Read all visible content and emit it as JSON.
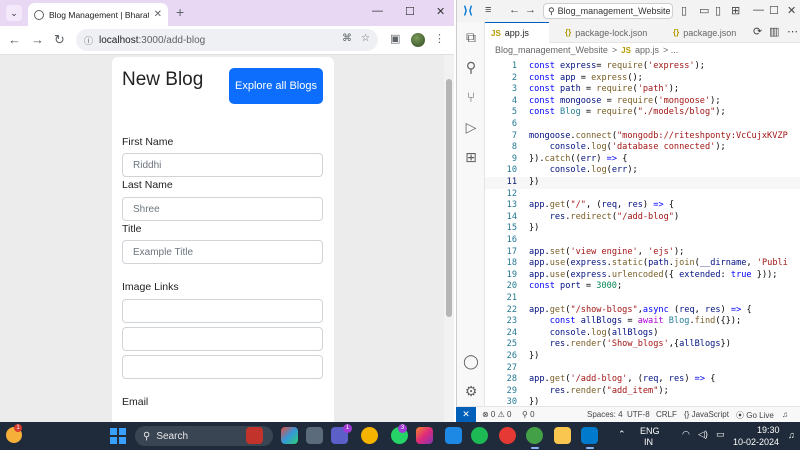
{
  "browser": {
    "tab_title": "Blog Management | Bharat Inte",
    "tab_close": "✕",
    "new_tab": "+",
    "url_host": "localhost",
    "url_path": ":3000/add-blog",
    "window_controls": {
      "minimize": "—",
      "maximize": "☐",
      "close": "✕"
    }
  },
  "page": {
    "heading": "New Blog",
    "explore_button": "Explore all Blogs",
    "first_name_label": "First Name",
    "first_name_placeholder": "Riddhi",
    "last_name_label": "Last Name",
    "last_name_placeholder": "Shree",
    "title_label": "Title",
    "title_placeholder": "Example Title",
    "image_links_label": "Image Links",
    "email_label": "Email"
  },
  "vscode": {
    "search_text": "Blog_management_Website",
    "tabs": [
      {
        "label": "app.js",
        "icon": "JS"
      },
      {
        "label": "package-lock.json",
        "icon": "{}"
      },
      {
        "label": "package.json",
        "icon": "{}"
      }
    ],
    "breadcrumb": {
      "folder": "Blog_management_Website",
      "sep": ">",
      "file_icon": "JS",
      "file": "app.js",
      "tail": "> ..."
    },
    "lines": [
      {
        "n": "1",
        "code": [
          [
            "kw",
            "const "
          ],
          [
            "var",
            "express"
          ],
          [
            "",
            "= "
          ],
          [
            "fn",
            "require"
          ],
          [
            "",
            "("
          ],
          [
            "str",
            "'express'"
          ],
          [
            "",
            ");"
          ]
        ]
      },
      {
        "n": "2",
        "code": [
          [
            "kw",
            "const "
          ],
          [
            "var",
            "app "
          ],
          [
            "",
            "= "
          ],
          [
            "fn",
            "express"
          ],
          [
            "",
            "();"
          ]
        ]
      },
      {
        "n": "3",
        "code": [
          [
            "kw",
            "const "
          ],
          [
            "var",
            "path "
          ],
          [
            "",
            "= "
          ],
          [
            "fn",
            "require"
          ],
          [
            "",
            "("
          ],
          [
            "str",
            "'path'"
          ],
          [
            "",
            ");"
          ]
        ]
      },
      {
        "n": "4",
        "code": [
          [
            "kw",
            "const "
          ],
          [
            "var",
            "mongoose "
          ],
          [
            "",
            "= "
          ],
          [
            "fn",
            "require"
          ],
          [
            "",
            "("
          ],
          [
            "str",
            "'mongoose'"
          ],
          [
            "",
            ");"
          ]
        ]
      },
      {
        "n": "5",
        "code": [
          [
            "kw",
            "const "
          ],
          [
            "cls",
            "Blog "
          ],
          [
            "",
            "= "
          ],
          [
            "fn",
            "require"
          ],
          [
            "",
            "("
          ],
          [
            "str",
            "\"./models/blog\""
          ],
          [
            "",
            ");"
          ]
        ]
      },
      {
        "n": "6",
        "code": []
      },
      {
        "n": "7",
        "code": [
          [
            "var",
            "mongoose"
          ],
          [
            "",
            "."
          ],
          [
            "fn",
            "connect"
          ],
          [
            "",
            "("
          ],
          [
            "str",
            "\"mongodb://riteshponty:VcCujxKVZP"
          ]
        ]
      },
      {
        "n": "8",
        "code": [
          [
            "",
            "    "
          ],
          [
            "var",
            "console"
          ],
          [
            "",
            "."
          ],
          [
            "fn",
            "log"
          ],
          [
            "",
            "("
          ],
          [
            "str",
            "'database connected'"
          ],
          [
            "",
            ");"
          ]
        ]
      },
      {
        "n": "9",
        "code": [
          [
            "",
            "})."
          ],
          [
            "fn",
            "catch"
          ],
          [
            "",
            "(("
          ],
          [
            "var",
            "err"
          ],
          [
            "",
            ") "
          ],
          [
            "kw",
            "=>"
          ],
          [
            "",
            " {"
          ]
        ]
      },
      {
        "n": "10",
        "code": [
          [
            "",
            "    "
          ],
          [
            "var",
            "console"
          ],
          [
            "",
            "."
          ],
          [
            "fn",
            "log"
          ],
          [
            "",
            "("
          ],
          [
            "var",
            "err"
          ],
          [
            "",
            ");"
          ]
        ]
      },
      {
        "n": "11",
        "code": [
          [
            "",
            "})"
          ]
        ],
        "current": true
      },
      {
        "n": "12",
        "code": []
      },
      {
        "n": "13",
        "code": [
          [
            "var",
            "app"
          ],
          [
            "",
            "."
          ],
          [
            "fn",
            "get"
          ],
          [
            "",
            "("
          ],
          [
            "str",
            "\"/\""
          ],
          [
            "",
            ", ("
          ],
          [
            "var",
            "req"
          ],
          [
            "",
            ", "
          ],
          [
            "var",
            "res"
          ],
          [
            "",
            ") "
          ],
          [
            "kw",
            "=>"
          ],
          [
            "",
            " {"
          ]
        ]
      },
      {
        "n": "14",
        "code": [
          [
            "",
            "    "
          ],
          [
            "var",
            "res"
          ],
          [
            "",
            "."
          ],
          [
            "fn",
            "redirect"
          ],
          [
            "",
            "("
          ],
          [
            "str",
            "\"/add-blog\""
          ],
          [
            "",
            ")"
          ]
        ]
      },
      {
        "n": "15",
        "code": [
          [
            "",
            "})"
          ]
        ]
      },
      {
        "n": "16",
        "code": []
      },
      {
        "n": "17",
        "code": [
          [
            "var",
            "app"
          ],
          [
            "",
            "."
          ],
          [
            "fn",
            "set"
          ],
          [
            "",
            "("
          ],
          [
            "str",
            "'view engine'"
          ],
          [
            "",
            ", "
          ],
          [
            "str",
            "'ejs'"
          ],
          [
            "",
            ");"
          ]
        ]
      },
      {
        "n": "18",
        "code": [
          [
            "var",
            "app"
          ],
          [
            "",
            "."
          ],
          [
            "fn",
            "use"
          ],
          [
            "",
            "("
          ],
          [
            "var",
            "express"
          ],
          [
            "",
            "."
          ],
          [
            "fn",
            "static"
          ],
          [
            "",
            "("
          ],
          [
            "var",
            "path"
          ],
          [
            "",
            "."
          ],
          [
            "fn",
            "join"
          ],
          [
            "",
            "("
          ],
          [
            "var",
            "__dirname"
          ],
          [
            "",
            ", "
          ],
          [
            "str",
            "'Publi"
          ]
        ]
      },
      {
        "n": "19",
        "code": [
          [
            "var",
            "app"
          ],
          [
            "",
            "."
          ],
          [
            "fn",
            "use"
          ],
          [
            "",
            "("
          ],
          [
            "var",
            "express"
          ],
          [
            "",
            "."
          ],
          [
            "fn",
            "urlencoded"
          ],
          [
            "",
            "({ "
          ],
          [
            "var",
            "extended"
          ],
          [
            "",
            ": "
          ],
          [
            "kw",
            "true"
          ],
          [
            "",
            " }));"
          ]
        ]
      },
      {
        "n": "20",
        "code": [
          [
            "kw",
            "const "
          ],
          [
            "var",
            "port "
          ],
          [
            "",
            "= "
          ],
          [
            "num",
            "3000"
          ],
          [
            "",
            ";"
          ]
        ]
      },
      {
        "n": "21",
        "code": []
      },
      {
        "n": "22",
        "code": [
          [
            "var",
            "app"
          ],
          [
            "",
            "."
          ],
          [
            "fn",
            "get"
          ],
          [
            "",
            "("
          ],
          [
            "str",
            "\"/show-blogs\""
          ],
          [
            "",
            ","
          ],
          [
            "kw",
            "async "
          ],
          [
            "",
            "("
          ],
          [
            "var",
            "req"
          ],
          [
            "",
            ", "
          ],
          [
            "var",
            "res"
          ],
          [
            "",
            ") "
          ],
          [
            "kw",
            "=>"
          ],
          [
            "",
            " {"
          ]
        ]
      },
      {
        "n": "23",
        "code": [
          [
            "",
            "    "
          ],
          [
            "kw",
            "const "
          ],
          [
            "var",
            "allBlogs "
          ],
          [
            "",
            "= "
          ],
          [
            "kw2",
            "await "
          ],
          [
            "cls",
            "Blog"
          ],
          [
            "",
            "."
          ],
          [
            "fn",
            "find"
          ],
          [
            "",
            "({});"
          ]
        ]
      },
      {
        "n": "24",
        "code": [
          [
            "",
            "    "
          ],
          [
            "var",
            "console"
          ],
          [
            "",
            "."
          ],
          [
            "fn",
            "log"
          ],
          [
            "",
            "("
          ],
          [
            "var",
            "allBlogs"
          ],
          [
            "",
            ")"
          ]
        ]
      },
      {
        "n": "25",
        "code": [
          [
            "",
            "    "
          ],
          [
            "var",
            "res"
          ],
          [
            "",
            "."
          ],
          [
            "fn",
            "render"
          ],
          [
            "",
            "("
          ],
          [
            "str",
            "'Show_blogs'"
          ],
          [
            "",
            ",{"
          ],
          [
            "var",
            "allBlogs"
          ],
          [
            "",
            "})"
          ]
        ]
      },
      {
        "n": "26",
        "code": [
          [
            "",
            "})"
          ]
        ]
      },
      {
        "n": "27",
        "code": []
      },
      {
        "n": "28",
        "code": [
          [
            "var",
            "app"
          ],
          [
            "",
            "."
          ],
          [
            "fn",
            "get"
          ],
          [
            "",
            "("
          ],
          [
            "str",
            "'/add-blog'"
          ],
          [
            "",
            ", ("
          ],
          [
            "var",
            "req"
          ],
          [
            "",
            ", "
          ],
          [
            "var",
            "res"
          ],
          [
            "",
            ") "
          ],
          [
            "kw",
            "=>"
          ],
          [
            "",
            " {"
          ]
        ]
      },
      {
        "n": "29",
        "code": [
          [
            "",
            "    "
          ],
          [
            "var",
            "res"
          ],
          [
            "",
            "."
          ],
          [
            "fn",
            "render"
          ],
          [
            "",
            "("
          ],
          [
            "str",
            "\"add_item\""
          ],
          [
            "",
            ");"
          ]
        ]
      },
      {
        "n": "30",
        "code": [
          [
            "",
            "})"
          ]
        ]
      }
    ],
    "status": {
      "remote": "✕",
      "problems": "⊗ 0 ⚠ 0",
      "ports": "⚲ 0",
      "spaces": "Spaces: 4",
      "encoding": "UTF-8",
      "eol": "CRLF",
      "language": "{} JavaScript",
      "golive": "⦿ Go Live",
      "bell": "🔔"
    }
  },
  "taskbar": {
    "search_label": "Search",
    "weather_badge": "1",
    "teams_badge": "1",
    "whatsapp_badge": "3",
    "lang_top": "ENG",
    "lang_bottom": "IN",
    "time": "19:30",
    "date": "10-02-2024"
  }
}
